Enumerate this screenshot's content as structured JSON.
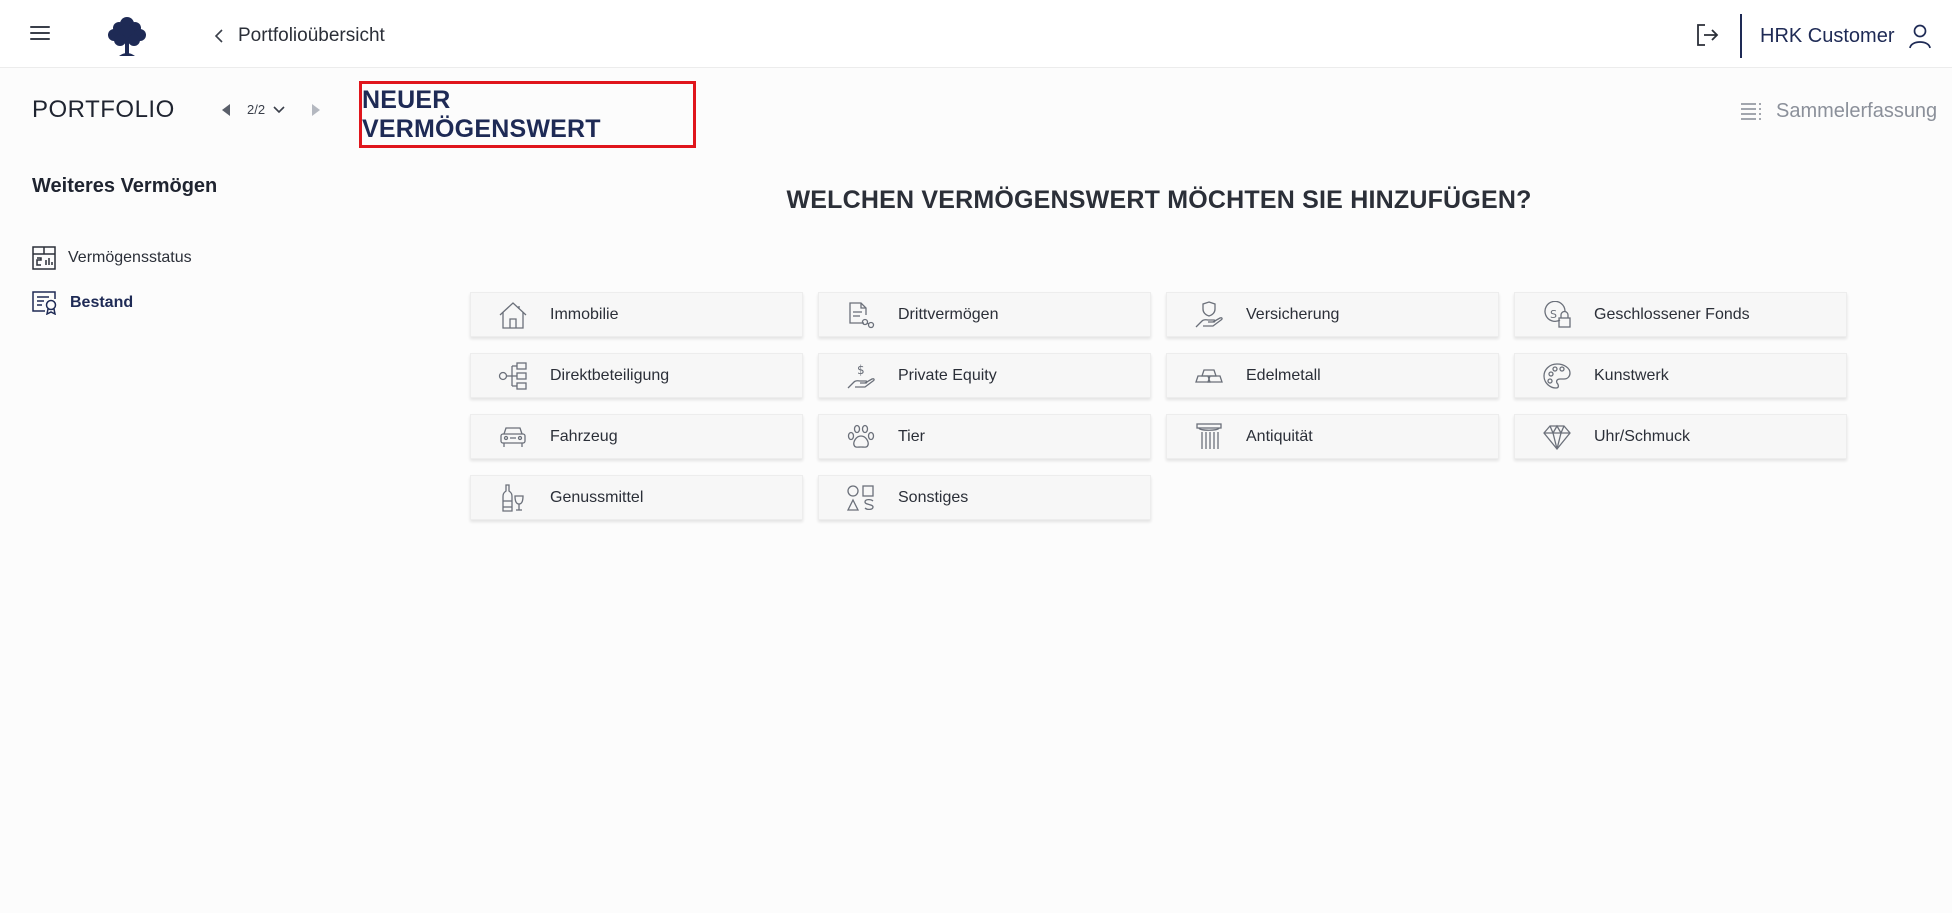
{
  "header": {
    "back_label": "Portfolioübersicht",
    "user_name": "HRK Customer"
  },
  "portfolio": {
    "title": "PORTFOLIO",
    "pager": "2/2",
    "new_asset_title": "NEUER VERMÖGENSWERT",
    "bulk_entry_label": "Sammelerfassung"
  },
  "sidebar": {
    "title": "Weiteres Vermögen",
    "items": [
      {
        "label": "Vermögensstatus",
        "icon": "status-table-icon",
        "active": false
      },
      {
        "label": "Bestand",
        "icon": "certificate-icon",
        "active": true
      }
    ]
  },
  "main": {
    "question": "WELCHEN VERMÖGENSWERT MÖCHTEN SIE HINZUFÜGEN?",
    "asset_types": [
      {
        "label": "Immobilie",
        "icon": "house-icon"
      },
      {
        "label": "Drittvermögen",
        "icon": "document-icon"
      },
      {
        "label": "Versicherung",
        "icon": "shield-hand-icon"
      },
      {
        "label": "Geschlossener Fonds",
        "icon": "coin-lock-icon"
      },
      {
        "label": "Direktbeteiligung",
        "icon": "hierarchy-icon"
      },
      {
        "label": "Private Equity",
        "icon": "dollar-hand-icon"
      },
      {
        "label": "Edelmetall",
        "icon": "gold-bars-icon"
      },
      {
        "label": "Kunstwerk",
        "icon": "palette-icon"
      },
      {
        "label": "Fahrzeug",
        "icon": "car-icon"
      },
      {
        "label": "Tier",
        "icon": "paw-icon"
      },
      {
        "label": "Antiquität",
        "icon": "column-icon"
      },
      {
        "label": "Uhr/Schmuck",
        "icon": "diamond-icon"
      },
      {
        "label": "Genussmittel",
        "icon": "wine-icon"
      },
      {
        "label": "Sonstiges",
        "icon": "shapes-icon"
      }
    ]
  },
  "colors": {
    "brand_navy": "#1e2a55",
    "highlight_red": "#e0161c",
    "muted_gray": "#8b909a"
  }
}
